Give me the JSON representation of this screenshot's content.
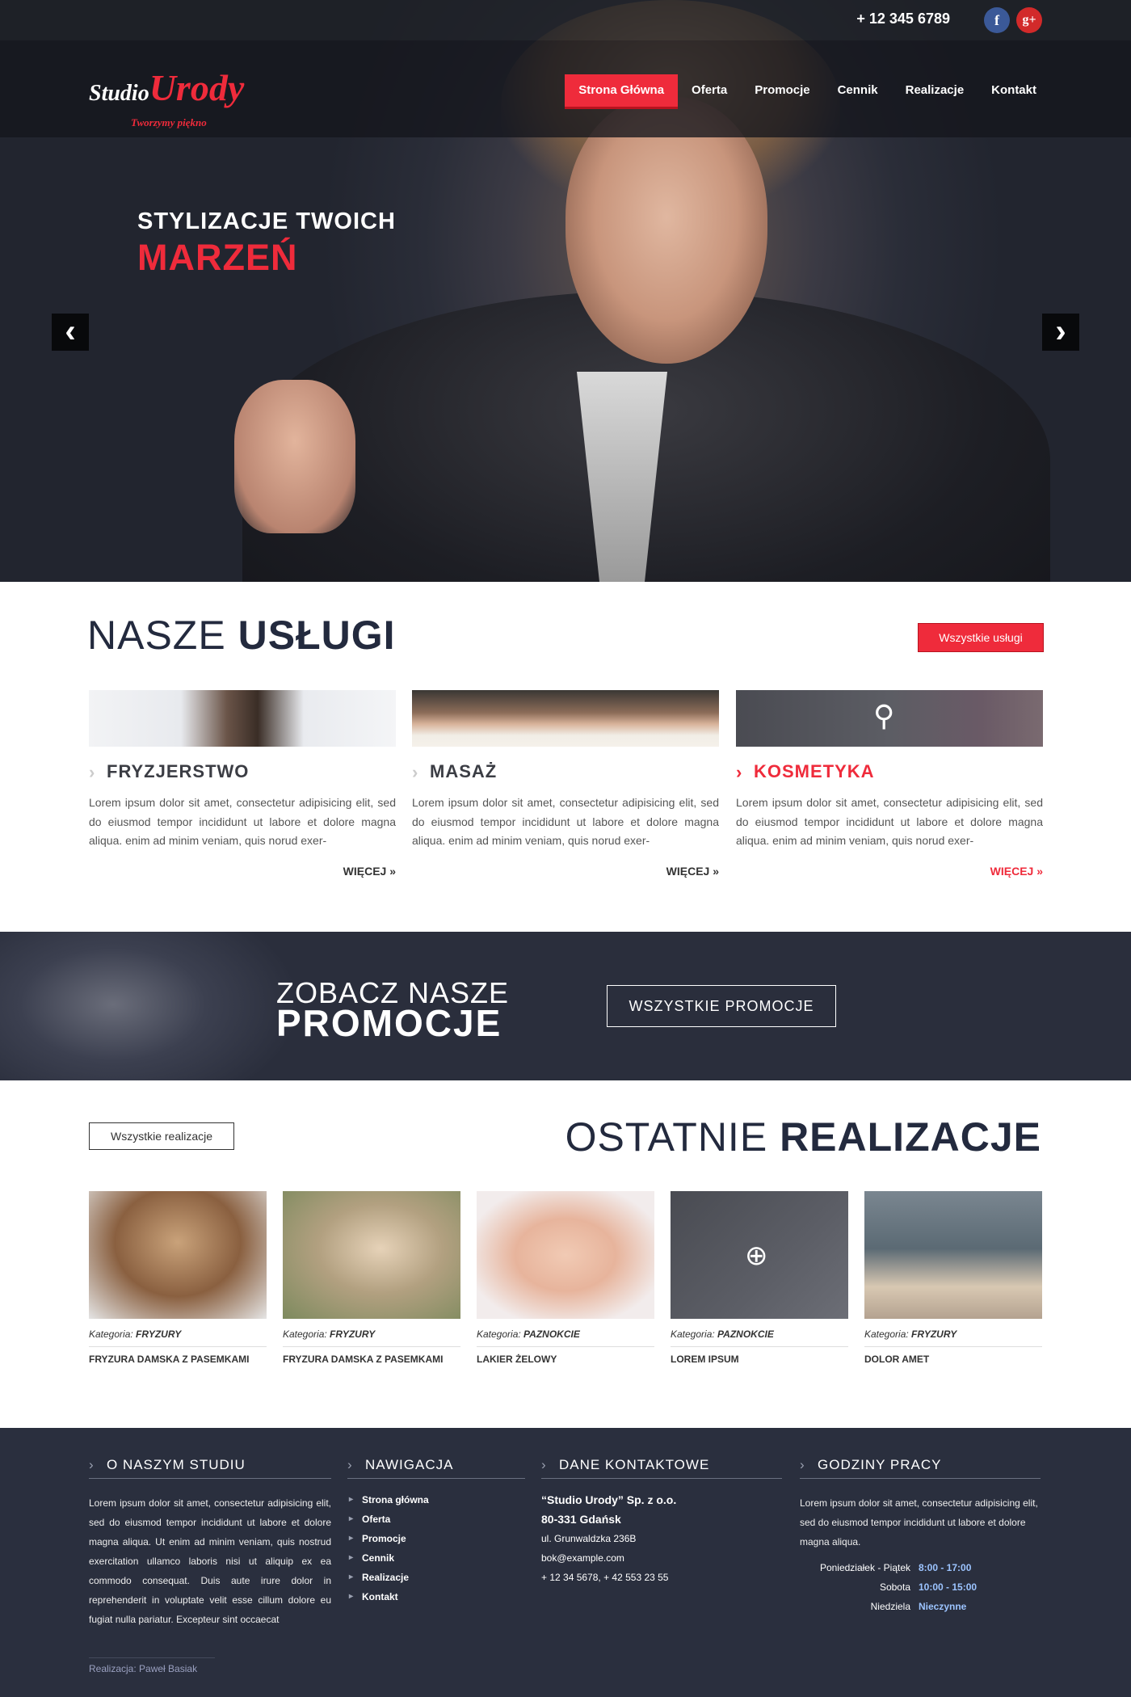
{
  "header": {
    "phone": "+ 12 345 6789",
    "social": {
      "facebook": "f",
      "google_plus": "g+"
    },
    "logo": {
      "studio": "Studio",
      "urody": "Urody",
      "tagline": "Tworzymy piękno"
    },
    "menu": [
      {
        "label": "Strona Główna",
        "active": true
      },
      {
        "label": "Oferta"
      },
      {
        "label": "Promocje"
      },
      {
        "label": "Cennik"
      },
      {
        "label": "Realizacje"
      },
      {
        "label": "Kontakt"
      }
    ]
  },
  "hero": {
    "line1": "STYLIZACJE TWOICH",
    "line2": "MARZEŃ",
    "prev_arrow": "‹",
    "next_arrow": "›"
  },
  "services": {
    "title_thin": "NASZE",
    "title_bold": "USŁUGI",
    "all_button": "Wszystkie usługi",
    "items": [
      {
        "title": "FRYZJERSTWO",
        "text": "Lorem ipsum dolor sit amet, consectetur adipisicing elit, sed do eiusmod tempor incididunt ut labore et dolore magna aliqua.  enim ad minim veniam, quis norud exer-",
        "more": "WIĘCEJ »"
      },
      {
        "title": "MASAŻ",
        "text": "Lorem ipsum dolor sit amet, consectetur adipisicing elit, sed do eiusmod tempor incididunt ut labore et dolore magna aliqua.  enim ad minim veniam, quis norud exer-",
        "more": "WIĘCEJ »"
      },
      {
        "title": "KOSMETYKA",
        "text": "Lorem ipsum dolor sit amet, consectetur adipisicing elit, sed do eiusmod tempor incididunt ut labore et dolore magna aliqua.  enim ad minim veniam, quis norud exer-",
        "more": "WIĘCEJ »"
      }
    ]
  },
  "promo": {
    "line1": "ZOBACZ NASZE",
    "line2": "PROMOCJE",
    "button": "WSZYSTKIE PROMOCJE"
  },
  "works": {
    "all_button": "Wszystkie realizacje",
    "title_thin": "OSTATNIE",
    "title_bold": "REALIZACJE",
    "category_label": "Kategoria:",
    "items": [
      {
        "category": "FRYZURY",
        "name": "FRYZURA DAMSKA Z PASEMKAMI"
      },
      {
        "category": "FRYZURY",
        "name": "FRYZURA DAMSKA Z PASEMKAMI"
      },
      {
        "category": "PAZNOKCIE",
        "name": "LAKIER ŻELOWY"
      },
      {
        "category": "PAZNOKCIE",
        "name": "LOREM IPSUM"
      },
      {
        "category": "FRYZURY",
        "name": "DOLOR AMET"
      }
    ]
  },
  "footer": {
    "about": {
      "title": "O NASZYM STUDIU",
      "text": "Lorem ipsum dolor sit amet, consectetur adipisicing elit, sed do eiusmod tempor incididunt ut labore et dolore magna aliqua. Ut enim ad minim veniam, quis nostrud exercitation ullamco laboris nisi ut aliquip ex ea commodo consequat. Duis aute irure dolor in reprehenderit in voluptate velit esse cillum dolore eu fugiat nulla pariatur. Excepteur sint occaecat"
    },
    "nav": {
      "title": "NAWIGACJA",
      "items": [
        "Strona główna",
        "Oferta",
        "Promocje",
        "Cennik",
        "Realizacje",
        "Kontakt"
      ]
    },
    "contact": {
      "title": "DANE KONTAKTOWE",
      "company": "“Studio Urody” Sp. z o.o.",
      "city": "80-331 Gdańsk",
      "street": "ul. Grunwaldzka 236B",
      "email": "bok@example.com",
      "phones": "+ 12 34 5678, + 42 553 23 55"
    },
    "hours": {
      "title": "GODZINY PRACY",
      "text": "Lorem ipsum dolor sit amet, consectetur adipisicing elit, sed do eiusmod tempor incididunt ut labore et dolore magna aliqua.",
      "rows": [
        {
          "day": "Poniedziałek - Piątek",
          "hours": "8:00 - 17:00"
        },
        {
          "day": "Sobota",
          "hours": "10:00 - 15:00"
        },
        {
          "day": "Niedziela",
          "hours": "Nieczynne"
        }
      ]
    },
    "credit": "Realizacja: Paweł Basiak"
  },
  "colors": {
    "accent": "#ef2b3b",
    "navy": "#232a3e",
    "footer_bg": "#2a2f3e"
  }
}
